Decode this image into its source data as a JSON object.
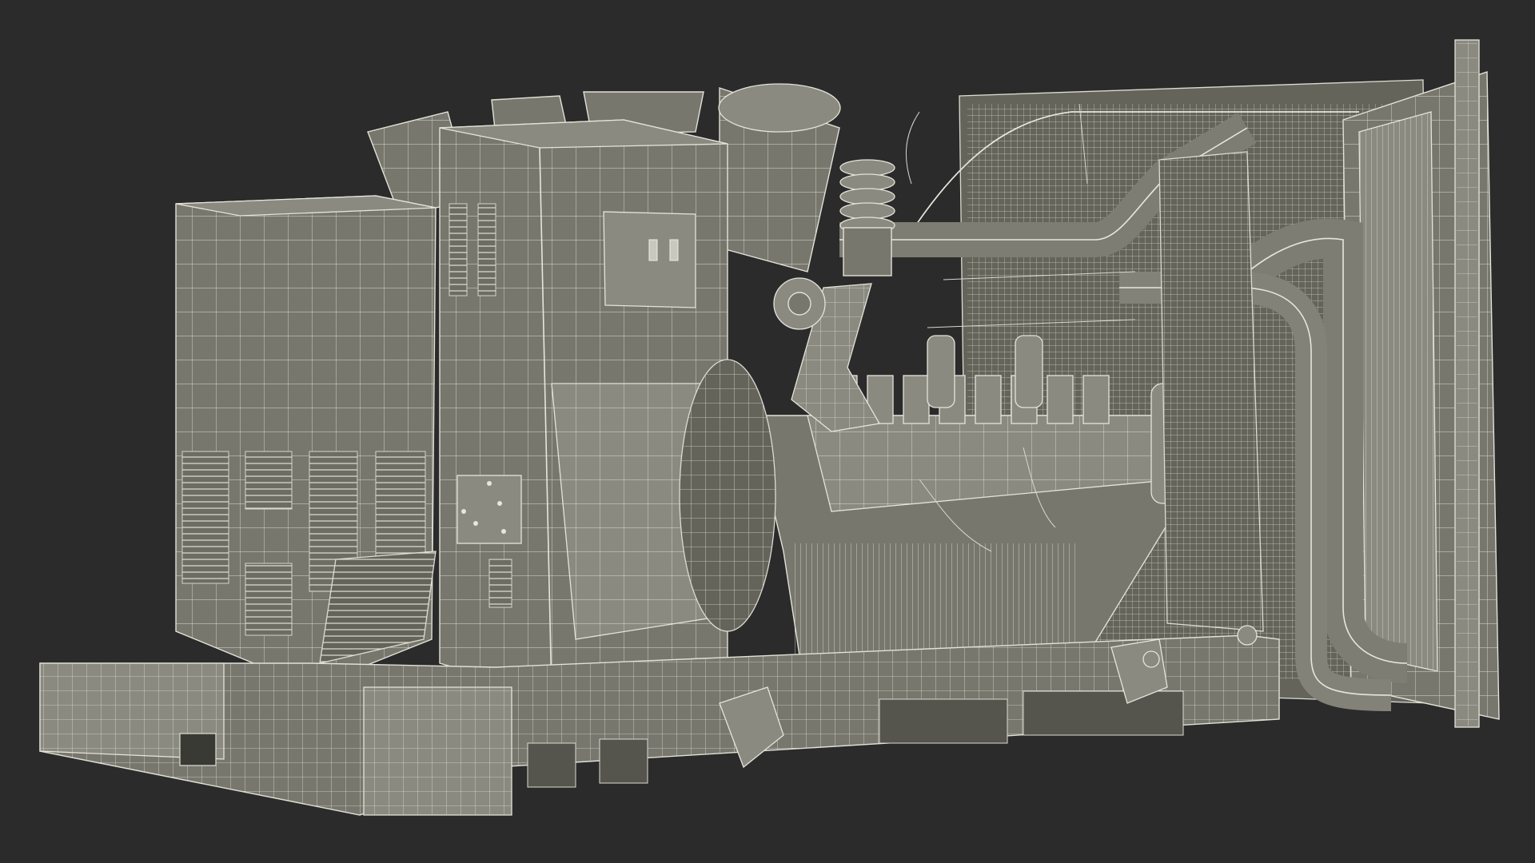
{
  "scene": {
    "background_color": "#2b2b2b",
    "model_fill_color": "#77776d",
    "wire_color": "#e2e2d8",
    "subject": "diesel-generator-set-wireframe"
  }
}
